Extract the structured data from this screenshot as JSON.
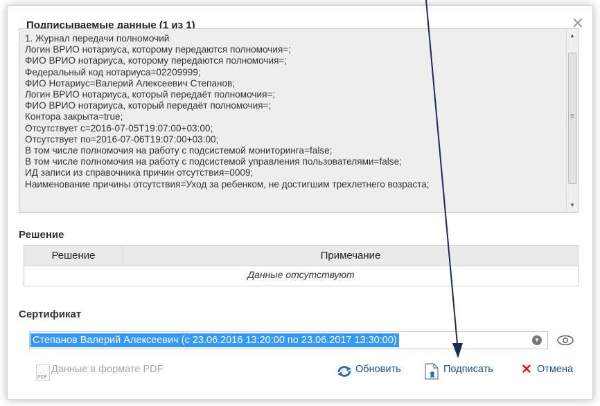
{
  "dialog": {
    "title": "Подписываемые данные (1 из 1)",
    "close_glyph": "✕",
    "data_lines": [
      "1. Журнал передачи полномочий",
      "Логин ВРИО нотариуса, которому передаются полномочия=;",
      "ФИО ВРИО нотариуса, которому передаются полномочия=;",
      "Федеральный код нотариуса=02209999;",
      "ФИО Нотариус=Валерий Алексеевич Степанов;",
      "Логин ВРИО нотариуса, который передаёт полномочия=;",
      "ФИО ВРИО нотариуса, который передаёт полномочия=;",
      "Контора закрыта=true;",
      "Отсутствует с=2016-07-05T19:07:00+03:00;",
      "Отсутствует по=2016-07-06T19:07:00+03:00;",
      "В том числе полномочия на работу с подсистемой мониторинга=false;",
      "В том числе полномочия на работу с подсистемой управления пользователями=false;",
      "ИД записи из справочника причин отсутствия=0009;",
      "Наименование причины отсутствия=Уход за ребенком, не достигшим трехлетнего возраста;"
    ]
  },
  "decision": {
    "section_label": "Решение",
    "col_decision": "Решение",
    "col_note": "Примечание",
    "empty_text": "Данные отсутствуют"
  },
  "certificate": {
    "section_label": "Сертификат",
    "selected_value": "Степанов Валерий  Алексеевич (с 23.06.2016 13:20:00 по 23.06.2017 13:30:00)"
  },
  "actions": {
    "pdf_label": "Данные в формате PDF",
    "pdf_icon_text": "PDF",
    "refresh_label": "Обновить",
    "sign_label": "Подписать",
    "cancel_label": "Отмена"
  },
  "colors": {
    "selection_bg": "#3399ff",
    "link_blue": "#1f4f8c",
    "cancel_red": "#e01a1a",
    "annotation_line": "#1a2a5a"
  }
}
